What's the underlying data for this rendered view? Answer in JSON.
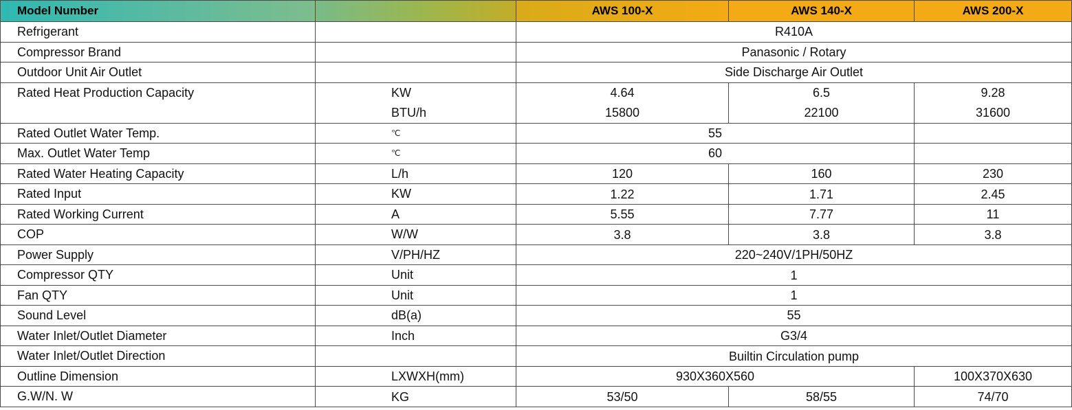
{
  "table": {
    "header": {
      "label": "Model Number",
      "models": [
        "AWS 100-X",
        "AWS 140-X",
        "AWS 200-X"
      ]
    },
    "rows": {
      "refrigerant": {
        "label": "Refrigerant",
        "value": "R410A"
      },
      "compressor_brand": {
        "label": "Compressor Brand",
        "value": "Panasonic / Rotary"
      },
      "air_outlet": {
        "label": "Outdoor Unit Air Outlet",
        "value": "Side Discharge Air Outlet"
      },
      "heat_capacity": {
        "label": "Rated Heat Production Capacity",
        "unit1": "KW",
        "unit2": "BTU/h",
        "kw": [
          "4.64",
          "6.5",
          "9.28"
        ],
        "btu": [
          "15800",
          "22100",
          "31600"
        ]
      },
      "outlet_temp": {
        "label": "Rated Outlet Water Temp.",
        "unit": "℃",
        "value": "55"
      },
      "max_outlet_temp": {
        "label": "Max. Outlet Water Temp",
        "unit": "℃",
        "value": "60"
      },
      "water_heating": {
        "label": "Rated Water Heating Capacity",
        "unit": "L/h",
        "values": [
          "120",
          "160",
          "230"
        ]
      },
      "rated_input": {
        "label": "Rated Input",
        "unit": "KW",
        "values": [
          "1.22",
          "1.71",
          "2.45"
        ]
      },
      "working_current": {
        "label": "Rated Working Current",
        "unit": "A",
        "values": [
          "5.55",
          "7.77",
          "11"
        ]
      },
      "cop": {
        "label": "COP",
        "unit": "W/W",
        "values": [
          "3.8",
          "3.8",
          "3.8"
        ]
      },
      "power_supply": {
        "label": "Power Supply",
        "unit": "V/PH/HZ",
        "value": "220~240V/1PH/50HZ"
      },
      "compressor_qty": {
        "label": "Compressor QTY",
        "unit": "Unit",
        "value": "1"
      },
      "fan_qty": {
        "label": "Fan QTY",
        "unit": "Unit",
        "value": "1"
      },
      "sound_level": {
        "label": "Sound Level",
        "unit": "dB(a)",
        "value": "55"
      },
      "pipe_diameter": {
        "label": "Water Inlet/Outlet Diameter",
        "unit": "Inch",
        "value": "G3/4"
      },
      "pipe_direction": {
        "label": "Water Inlet/Outlet Direction",
        "value": "Builtin Circulation pump"
      },
      "dimension": {
        "label": "Outline Dimension",
        "unit": "LXWXH(mm)",
        "value_shared": "930X360X560",
        "value_last": "100X370X630"
      },
      "weight": {
        "label": "G.W/N. W",
        "unit": "KG",
        "values": [
          "53/50",
          "58/55",
          "74/70"
        ]
      }
    }
  }
}
